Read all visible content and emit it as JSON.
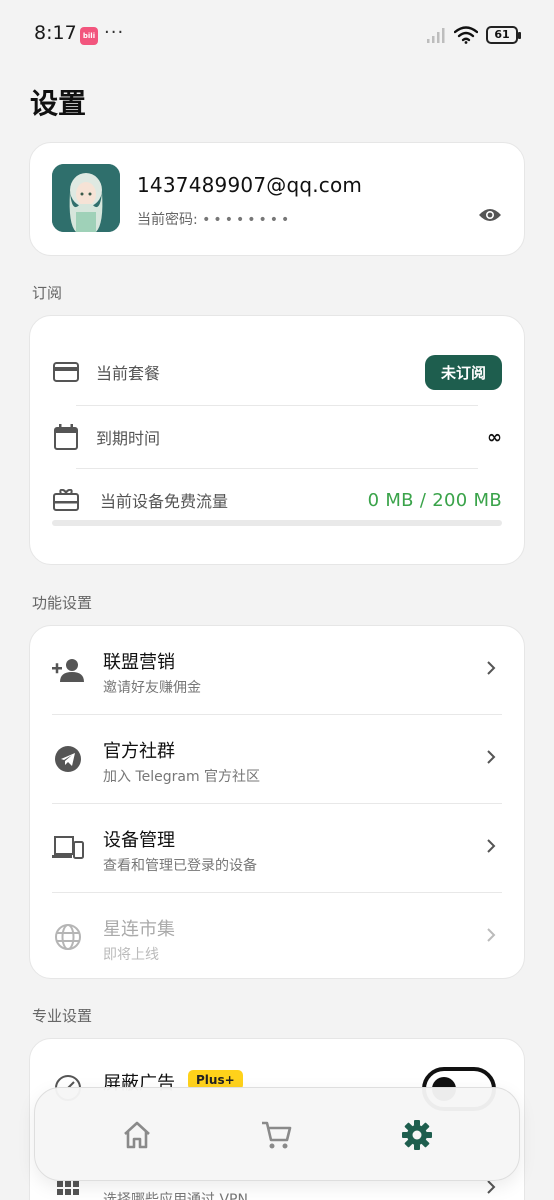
{
  "status_bar": {
    "time": "8:17",
    "app_icon_text": "bili",
    "dots": "···",
    "battery": "61"
  },
  "page": {
    "title": "设置"
  },
  "account": {
    "email": "1437489907@qq.com",
    "password_label": "当前密码:",
    "password_mask": "••••••••"
  },
  "subscription": {
    "section_label": "订阅",
    "current_plan_label": "当前套餐",
    "current_plan_badge": "未订阅",
    "expiry_label": "到期时间",
    "expiry_value": "∞",
    "traffic_label": "当前设备免费流量",
    "traffic_value": "0 MB / 200 MB",
    "traffic_fraction": 0.0
  },
  "features": {
    "section_label": "功能设置",
    "items": [
      {
        "title": "联盟营销",
        "subtitle": "邀请好友赚佣金",
        "icon": "person-add-icon",
        "enabled": true
      },
      {
        "title": "官方社群",
        "subtitle": "加入 Telegram 官方社区",
        "icon": "telegram-icon",
        "enabled": true
      },
      {
        "title": "设备管理",
        "subtitle": "查看和管理已登录的设备",
        "icon": "devices-icon",
        "enabled": true
      },
      {
        "title": "星连市集",
        "subtitle": "即将上线",
        "icon": "globe-icon",
        "enabled": false
      }
    ]
  },
  "pro": {
    "section_label": "专业设置",
    "block_ads_title": "屏蔽广告",
    "plus_badge": "Plus+",
    "second_subtitle": "选择哪些应用通过 VPN"
  },
  "colors": {
    "accent": "#1e5e4e",
    "traffic_green": "#3aa34a",
    "plus_yellow": "#ffd21a"
  },
  "bottom_nav": [
    "home-icon",
    "cart-icon",
    "settings-gear-icon"
  ]
}
